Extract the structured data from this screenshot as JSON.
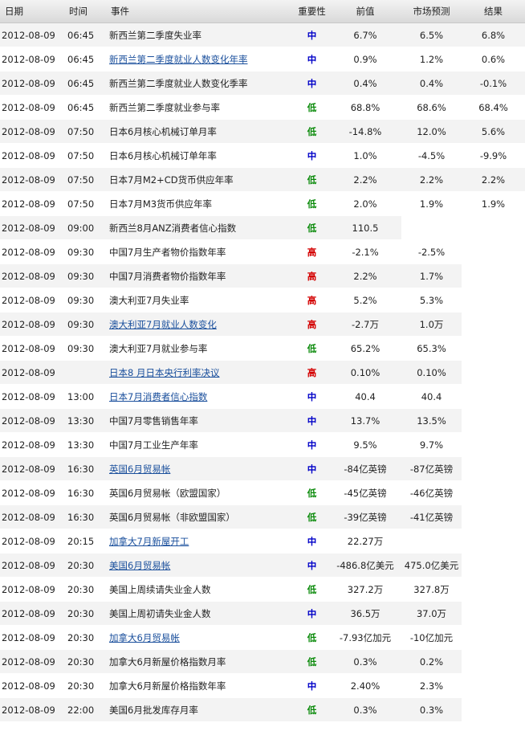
{
  "headers": {
    "date": "日期",
    "time": "时间",
    "event": "事件",
    "importance": "重要性",
    "previous": "前值",
    "forecast": "市场预测",
    "actual": "结果"
  },
  "colors": {
    "high": "#d40000",
    "medium": "#0000c8",
    "low": "#0a8a0a",
    "link": "#1a4f9c"
  },
  "rows": [
    {
      "date": "2012-08-09",
      "time": "06:45",
      "event": "新西兰第二季度失业率",
      "link": false,
      "importance": "中",
      "level": "medium",
      "previous": "6.7%",
      "forecast": "6.5%",
      "actual": "6.8%"
    },
    {
      "date": "2012-08-09",
      "time": "06:45",
      "event": "新西兰第二季度就业人数变化年率",
      "link": true,
      "importance": "中",
      "level": "medium",
      "previous": "0.9%",
      "forecast": "1.2%",
      "actual": "0.6%"
    },
    {
      "date": "2012-08-09",
      "time": "06:45",
      "event": "新西兰第二季度就业人数变化季率",
      "link": false,
      "importance": "中",
      "level": "medium",
      "previous": "0.4%",
      "forecast": "0.4%",
      "actual": "-0.1%"
    },
    {
      "date": "2012-08-09",
      "time": "06:45",
      "event": "新西兰第二季度就业参与率",
      "link": false,
      "importance": "低",
      "level": "low",
      "previous": "68.8%",
      "forecast": "68.6%",
      "actual": "68.4%"
    },
    {
      "date": "2012-08-09",
      "time": "07:50",
      "event": "日本6月核心机械订单月率",
      "link": false,
      "importance": "低",
      "level": "low",
      "previous": "-14.8%",
      "forecast": "12.0%",
      "actual": "5.6%"
    },
    {
      "date": "2012-08-09",
      "time": "07:50",
      "event": "日本6月核心机械订单年率",
      "link": false,
      "importance": "中",
      "level": "medium",
      "previous": "1.0%",
      "forecast": "-4.5%",
      "actual": "-9.9%"
    },
    {
      "date": "2012-08-09",
      "time": "07:50",
      "event": "日本7月M2+CD货币供应年率",
      "link": false,
      "importance": "低",
      "level": "low",
      "previous": "2.2%",
      "forecast": "2.2%",
      "actual": "2.2%"
    },
    {
      "date": "2012-08-09",
      "time": "07:50",
      "event": "日本7月M3货币供应年率",
      "link": false,
      "importance": "低",
      "level": "low",
      "previous": "2.0%",
      "forecast": "1.9%",
      "actual": "1.9%"
    },
    {
      "date": "2012-08-09",
      "time": "09:00",
      "event": "新西兰8月ANZ消费者信心指数",
      "link": false,
      "importance": "低",
      "level": "low",
      "previous": "110.5",
      "forecast": "",
      "actual": ""
    },
    {
      "date": "2012-08-09",
      "time": "09:30",
      "event": "中国7月生产者物价指数年率",
      "link": false,
      "importance": "高",
      "level": "high",
      "previous": "-2.1%",
      "forecast": "-2.5%",
      "actual": ""
    },
    {
      "date": "2012-08-09",
      "time": "09:30",
      "event": "中国7月消费者物价指数年率",
      "link": false,
      "importance": "高",
      "level": "high",
      "previous": "2.2%",
      "forecast": "1.7%",
      "actual": ""
    },
    {
      "date": "2012-08-09",
      "time": "09:30",
      "event": "澳大利亚7月失业率",
      "link": false,
      "importance": "高",
      "level": "high",
      "previous": "5.2%",
      "forecast": "5.3%",
      "actual": ""
    },
    {
      "date": "2012-08-09",
      "time": "09:30",
      "event": "澳大利亚7月就业人数变化",
      "link": true,
      "importance": "高",
      "level": "high",
      "previous": "-2.7万",
      "forecast": "1.0万",
      "actual": ""
    },
    {
      "date": "2012-08-09",
      "time": "09:30",
      "event": "澳大利亚7月就业参与率",
      "link": false,
      "importance": "低",
      "level": "low",
      "previous": "65.2%",
      "forecast": "65.3%",
      "actual": ""
    },
    {
      "date": "2012-08-09",
      "time": "",
      "event": "日本8 月日本央行利率决议",
      "link": true,
      "importance": "高",
      "level": "high",
      "previous": "0.10%",
      "forecast": "0.10%",
      "actual": ""
    },
    {
      "date": "2012-08-09",
      "time": "13:00",
      "event": "日本7月消费者信心指数",
      "link": true,
      "importance": "中",
      "level": "medium",
      "previous": "40.4",
      "forecast": "40.4",
      "actual": ""
    },
    {
      "date": "2012-08-09",
      "time": "13:30",
      "event": "中国7月零售销售年率",
      "link": false,
      "importance": "中",
      "level": "medium",
      "previous": "13.7%",
      "forecast": "13.5%",
      "actual": ""
    },
    {
      "date": "2012-08-09",
      "time": "13:30",
      "event": "中国7月工业生产年率",
      "link": false,
      "importance": "中",
      "level": "medium",
      "previous": "9.5%",
      "forecast": "9.7%",
      "actual": ""
    },
    {
      "date": "2012-08-09",
      "time": "16:30",
      "event": "英国6月贸易帐",
      "link": true,
      "importance": "中",
      "level": "medium",
      "previous": "-84亿英镑",
      "forecast": "-87亿英镑",
      "actual": ""
    },
    {
      "date": "2012-08-09",
      "time": "16:30",
      "event": "英国6月贸易帐（欧盟国家）",
      "link": false,
      "importance": "低",
      "level": "low",
      "previous": "-45亿英镑",
      "forecast": "-46亿英镑",
      "actual": ""
    },
    {
      "date": "2012-08-09",
      "time": "16:30",
      "event": "英国6月贸易帐（非欧盟国家）",
      "link": false,
      "importance": "低",
      "level": "low",
      "previous": "-39亿英镑",
      "forecast": "-41亿英镑",
      "actual": ""
    },
    {
      "date": "2012-08-09",
      "time": "20:15",
      "event": "加拿大7月新屋开工",
      "link": true,
      "importance": "中",
      "level": "medium",
      "previous": "22.27万",
      "forecast": "",
      "actual": ""
    },
    {
      "date": "2012-08-09",
      "time": "20:30",
      "event": "美国6月贸易帐",
      "link": true,
      "importance": "中",
      "level": "medium",
      "previous": "-486.8亿美元",
      "forecast": "475.0亿美元",
      "actual": ""
    },
    {
      "date": "2012-08-09",
      "time": "20:30",
      "event": "美国上周续请失业金人数",
      "link": false,
      "importance": "低",
      "level": "low",
      "previous": "327.2万",
      "forecast": "327.8万",
      "actual": ""
    },
    {
      "date": "2012-08-09",
      "time": "20:30",
      "event": "美国上周初请失业金人数",
      "link": false,
      "importance": "中",
      "level": "medium",
      "previous": "36.5万",
      "forecast": "37.0万",
      "actual": ""
    },
    {
      "date": "2012-08-09",
      "time": "20:30",
      "event": "加拿大6月贸易帐",
      "link": true,
      "importance": "低",
      "level": "low",
      "previous": "-7.93亿加元",
      "forecast": "-10亿加元",
      "actual": ""
    },
    {
      "date": "2012-08-09",
      "time": "20:30",
      "event": "加拿大6月新屋价格指数月率",
      "link": false,
      "importance": "低",
      "level": "low",
      "previous": "0.3%",
      "forecast": "0.2%",
      "actual": ""
    },
    {
      "date": "2012-08-09",
      "time": "20:30",
      "event": "加拿大6月新屋价格指数年率",
      "link": false,
      "importance": "中",
      "level": "medium",
      "previous": "2.40%",
      "forecast": "2.3%",
      "actual": ""
    },
    {
      "date": "2012-08-09",
      "time": "22:00",
      "event": "美国6月批发库存月率",
      "link": false,
      "importance": "低",
      "level": "low",
      "previous": "0.3%",
      "forecast": "0.3%",
      "actual": ""
    }
  ]
}
